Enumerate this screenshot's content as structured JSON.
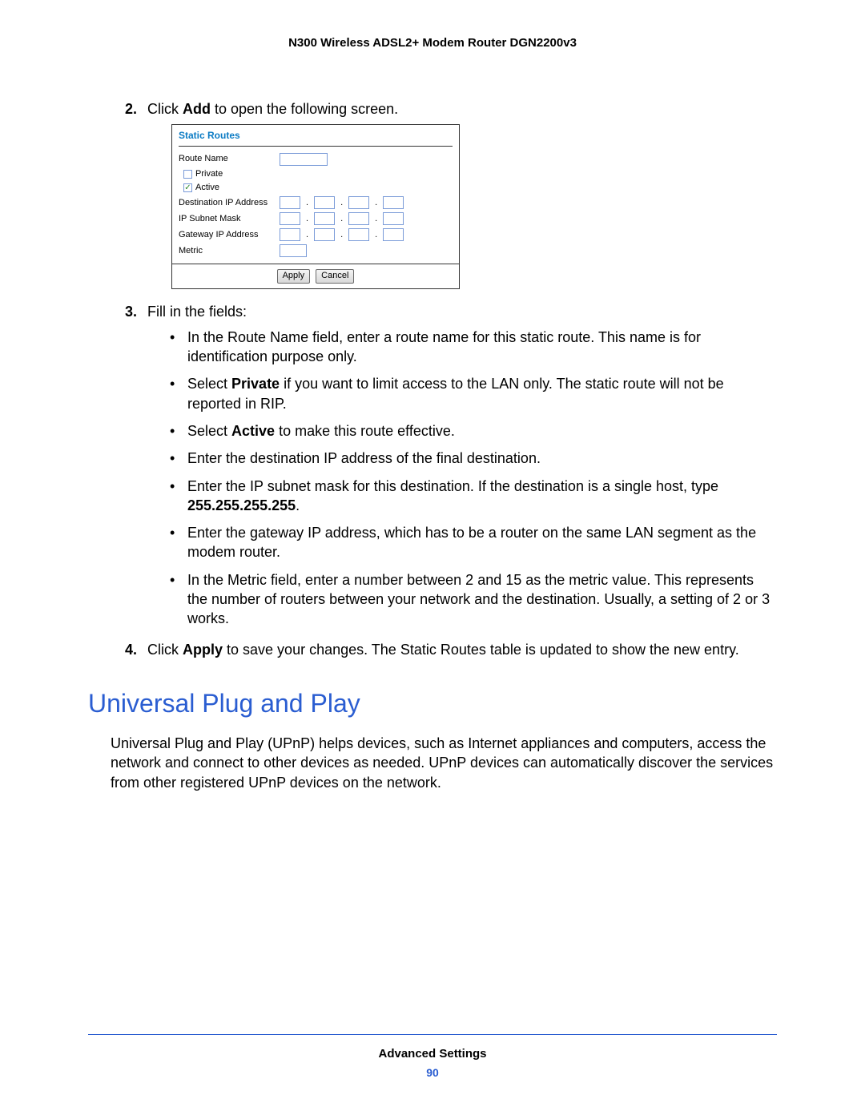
{
  "header": {
    "title": "N300 Wireless ADSL2+ Modem Router DGN2200v3"
  },
  "steps": {
    "s2": {
      "num": "2.",
      "pre": "Click ",
      "bold": "Add",
      "post": " to open the following screen."
    },
    "s3": {
      "num": "3.",
      "text": "Fill in the fields:",
      "bullets": {
        "b1": "In the Route Name field, enter a route name for this static route. This name is for identification purpose only.",
        "b2_pre": "Select ",
        "b2_bold": "Private",
        "b2_post": " if you want to limit access to the LAN only. The static route will not be reported in RIP.",
        "b3_pre": "Select ",
        "b3_bold": "Active",
        "b3_post": " to make this route effective.",
        "b4": "Enter the destination IP address of the final destination.",
        "b5_pre": "Enter the IP subnet mask for this destination. If the destination is a single host, type ",
        "b5_bold": "255.255.255.255",
        "b5_post": ".",
        "b6": "Enter the gateway IP address, which has to be a router on the same LAN segment as the modem router.",
        "b7": "In the Metric field, enter a number between 2 and 15 as the metric value. This represents the number of routers between your network and the destination. Usually, a setting of 2 or 3 works."
      }
    },
    "s4": {
      "num": "4.",
      "pre": "Click ",
      "bold": "Apply",
      "post": " to save your changes. The Static Routes table is updated to show the new entry."
    }
  },
  "router_panel": {
    "title": "Static Routes",
    "labels": {
      "route_name": "Route Name",
      "private": "Private",
      "active": "Active",
      "dest_ip": "Destination IP Address",
      "subnet": "IP Subnet Mask",
      "gateway": "Gateway IP Address",
      "metric": "Metric"
    },
    "buttons": {
      "apply": "Apply",
      "cancel": "Cancel"
    },
    "active_checked": "✓"
  },
  "section": {
    "heading": "Universal Plug and Play",
    "body": "Universal Plug and Play (UPnP) helps devices, such as Internet appliances and computers, access the network and connect to other devices as needed. UPnP devices can automatically discover the services from other registered UPnP devices on the network."
  },
  "footer": {
    "section": "Advanced Settings",
    "page": "90"
  }
}
